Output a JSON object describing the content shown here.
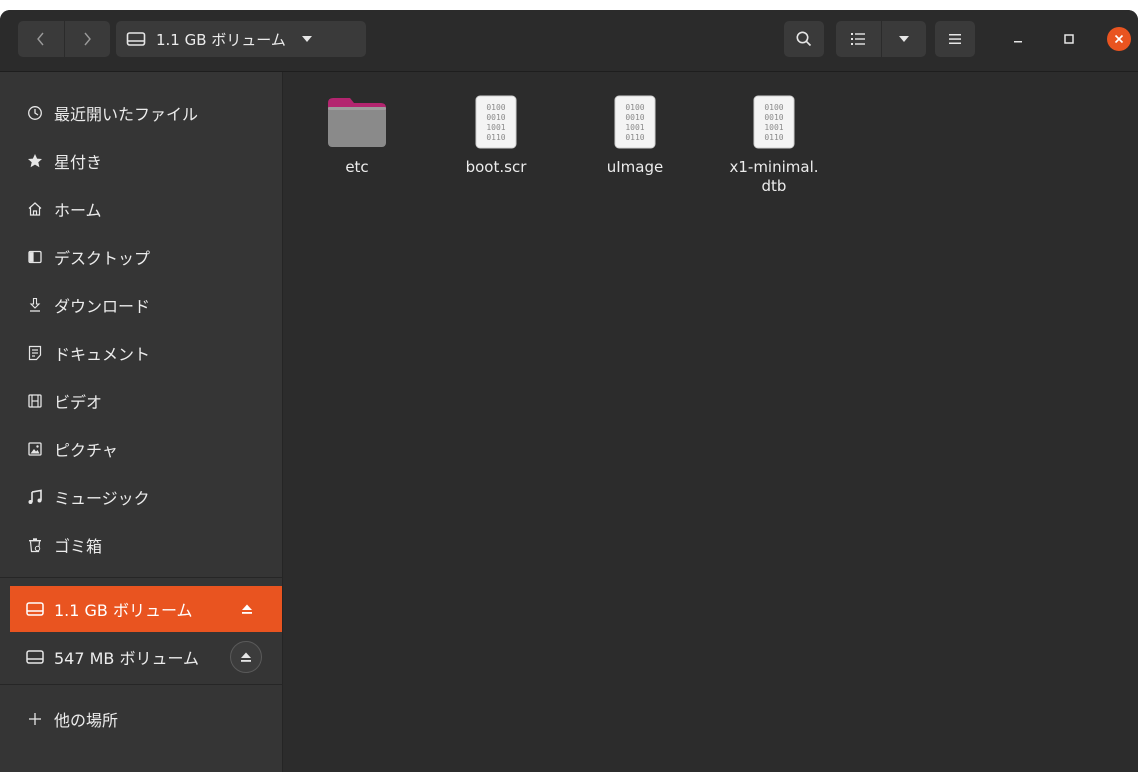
{
  "header": {
    "path_label": "1.1 GB ボリューム"
  },
  "sidebar": {
    "items": [
      {
        "label": "最近開いたファイル",
        "icon": "clock-icon"
      },
      {
        "label": "星付き",
        "icon": "star-icon"
      },
      {
        "label": "ホーム",
        "icon": "home-icon"
      },
      {
        "label": "デスクトップ",
        "icon": "desktop-icon"
      },
      {
        "label": "ダウンロード",
        "icon": "download-icon"
      },
      {
        "label": "ドキュメント",
        "icon": "document-icon"
      },
      {
        "label": "ビデオ",
        "icon": "video-icon"
      },
      {
        "label": "ピクチャ",
        "icon": "picture-icon"
      },
      {
        "label": "ミュージック",
        "icon": "music-icon"
      },
      {
        "label": "ゴミ箱",
        "icon": "trash-icon"
      }
    ],
    "volumes": [
      {
        "label": "1.1 GB ボリューム",
        "icon": "drive-icon",
        "active": true
      },
      {
        "label": "547 MB ボリューム",
        "icon": "drive-icon",
        "active": false
      }
    ],
    "other_locations": "他の場所"
  },
  "files": [
    {
      "name": "etc",
      "type": "folder"
    },
    {
      "name": "boot.scr",
      "type": "binary",
      "preview": "0100\n0010\n1001\n0110"
    },
    {
      "name": "uImage",
      "type": "binary",
      "preview": "0100\n0010\n1001\n0110"
    },
    {
      "name": "x1-minimal.\ndtb",
      "type": "binary",
      "preview": "0100\n0010\n1001\n0110"
    }
  ],
  "colors": {
    "accent": "#e95420",
    "folder": "#8a8a8a",
    "folder_tab": "#b3256f"
  }
}
